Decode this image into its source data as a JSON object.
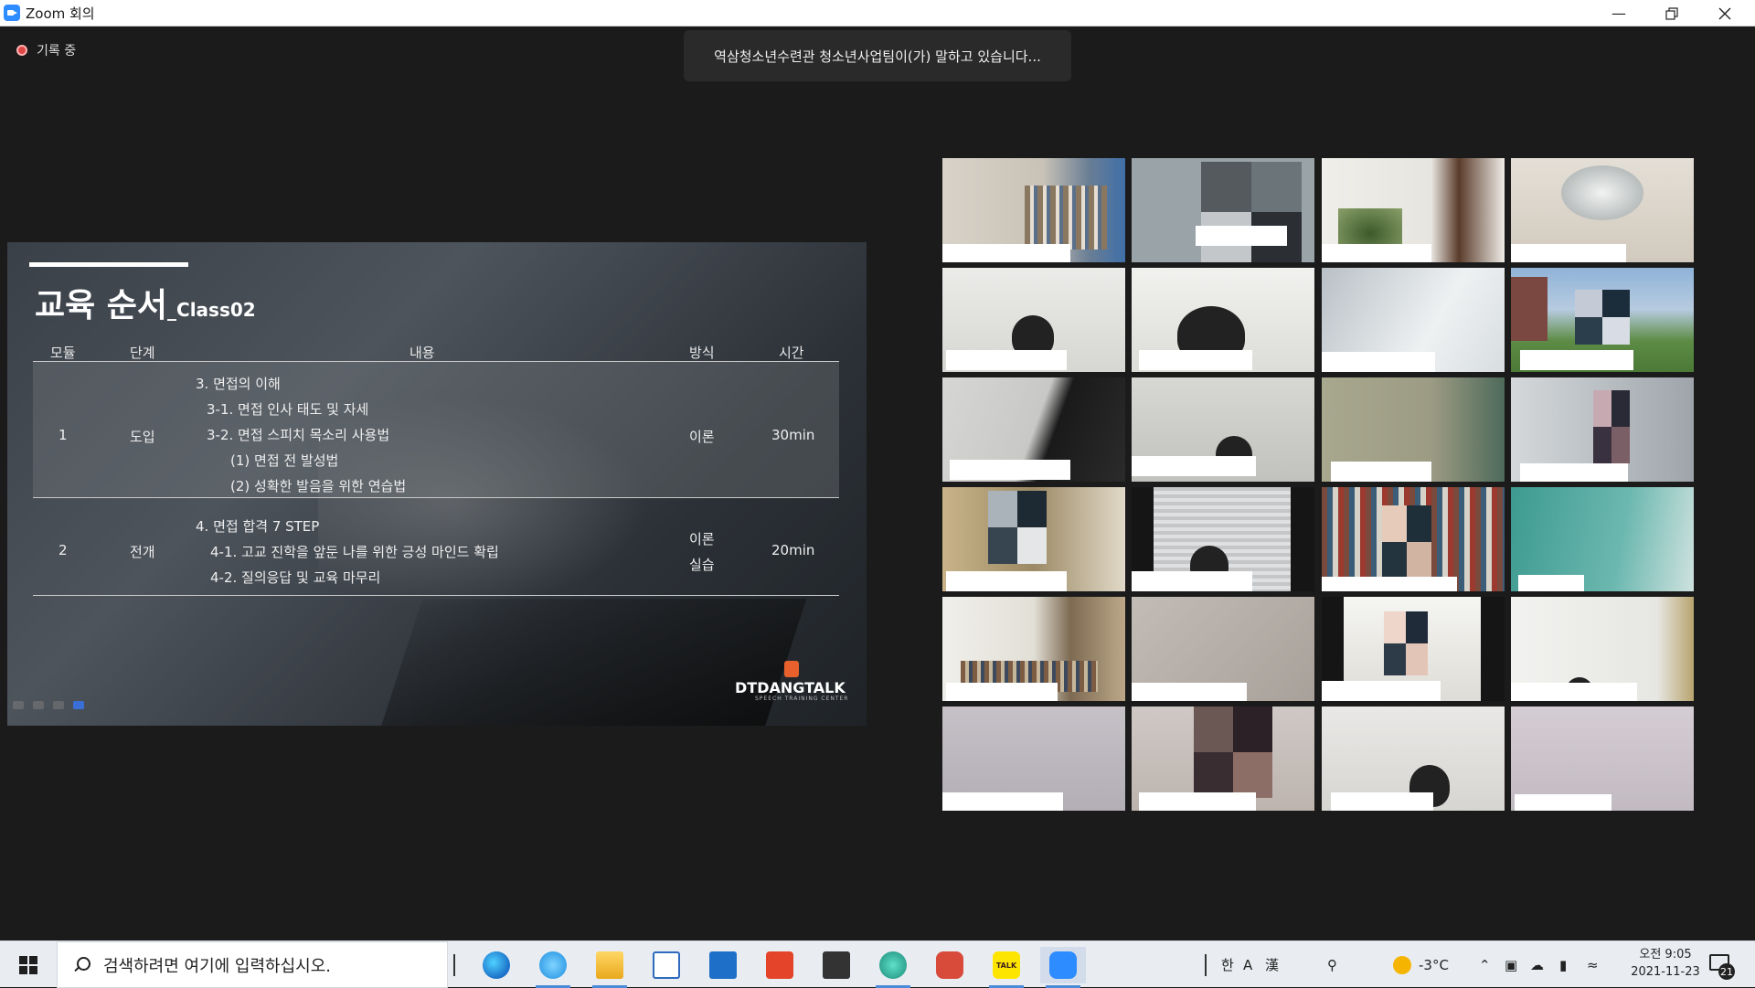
{
  "window": {
    "title": "Zoom 회의"
  },
  "meeting": {
    "recording_label": "기록 중",
    "speaking_banner": "역삼청소년수련관 청소년사업팀이(가) 말하고 있습니다..."
  },
  "slide": {
    "title_main": "교육 순서",
    "title_sub": "_Class02",
    "headers": {
      "module": "모듈",
      "stage": "단계",
      "content": "내용",
      "method": "방식",
      "time": "시간"
    },
    "rows": [
      {
        "module": "1",
        "stage": "도입",
        "lines": [
          "3. 면접의 이해",
          "3-1. 면접 인사 태도 및 자세",
          "3-2. 면접 스피치 목소리 사용법",
          "(1) 면접 전 발성법",
          "(2)  성확한 발음을 위한 연습법"
        ],
        "method": "이론",
        "time": "30min"
      },
      {
        "module": "2",
        "stage": "전개",
        "lines": [
          "4. 면접 합격 7 STEP",
          "4-1. 고교 진학을 앞둔 나를 위한 긍성 마인드 확립",
          "4-2. 질의응답 및 교육 마무리"
        ],
        "method_lines": [
          "이론",
          "실습"
        ],
        "time": "20min"
      }
    ],
    "brand": "DTDANGTALK",
    "brand_sub": "SPEECH TRAINING CENTER"
  },
  "taskbar": {
    "search_placeholder": "검색하려면 여기에 입력하십시오.",
    "ime_han": "한",
    "ime_a": "A",
    "ime_hanja": "漢",
    "weather": "-3°C",
    "time": "오전 9:05",
    "date": "2021-11-23",
    "notifications": "21"
  },
  "colors": {
    "zoom_blue": "#2d8cff",
    "rec_red": "#e04848",
    "background": "#1b1b1b"
  }
}
